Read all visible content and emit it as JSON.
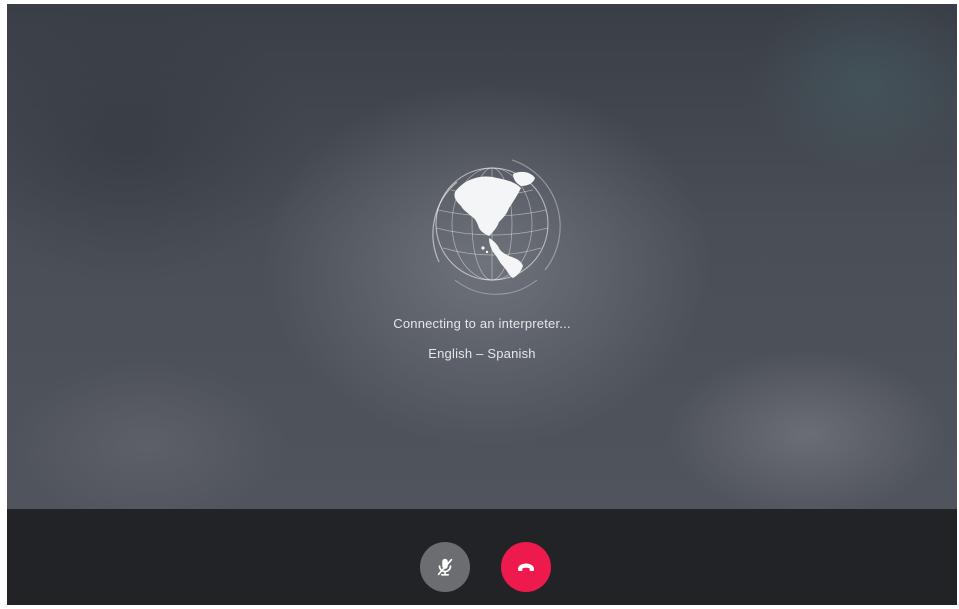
{
  "connection": {
    "status_message": "Connecting to an interpreter...",
    "language_pair": "English – Spanish"
  },
  "controls": {
    "mute_icon": "microphone-off-icon",
    "hangup_icon": "phone-hangup-icon"
  },
  "colors": {
    "hangup_button": "#ee1a4e",
    "mute_button": "#6b6d71",
    "control_bar": "#212327"
  }
}
